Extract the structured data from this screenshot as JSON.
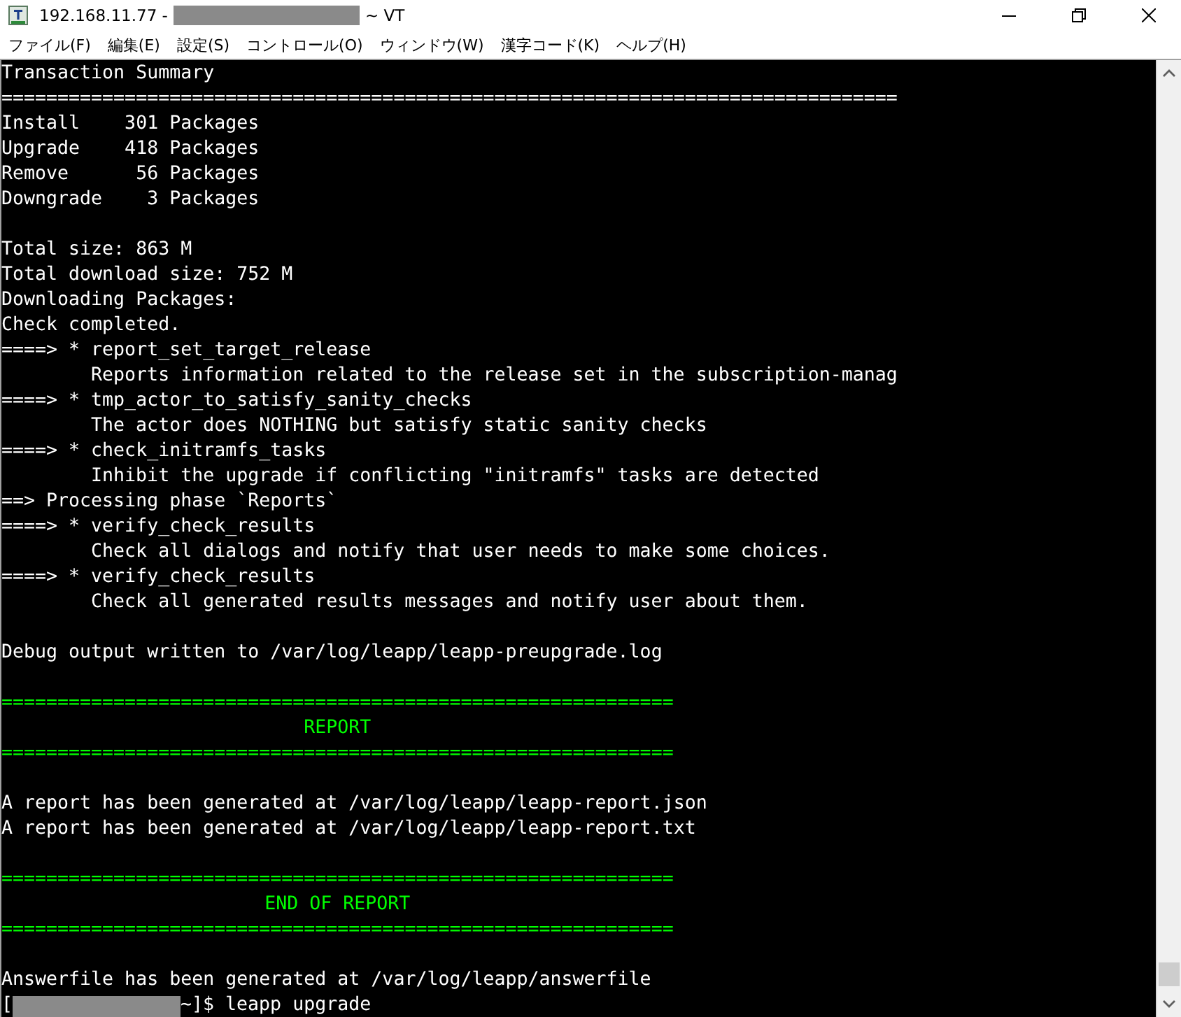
{
  "window": {
    "title_host": "192.168.11.77 -",
    "title_suffix": "~ VT"
  },
  "menu": [
    "ファイル(F)",
    "編集(E)",
    "設定(S)",
    "コントロール(O)",
    "ウィンドウ(W)",
    "漢字コード(K)",
    "ヘルプ(H)"
  ],
  "terminal": {
    "lines": [
      {
        "kind": "text",
        "text": "Transaction Summary"
      },
      {
        "kind": "text",
        "text": "================================================================================"
      },
      {
        "kind": "text",
        "text": "Install    301 Packages"
      },
      {
        "kind": "text",
        "text": "Upgrade    418 Packages"
      },
      {
        "kind": "text",
        "text": "Remove      56 Packages"
      },
      {
        "kind": "text",
        "text": "Downgrade    3 Packages"
      },
      {
        "kind": "blank"
      },
      {
        "kind": "text",
        "text": "Total size: 863 M"
      },
      {
        "kind": "text",
        "text": "Total download size: 752 M"
      },
      {
        "kind": "text",
        "text": "Downloading Packages:"
      },
      {
        "kind": "text",
        "text": "Check completed."
      },
      {
        "kind": "text",
        "text": "====> * report_set_target_release"
      },
      {
        "kind": "detail",
        "text": "Reports information related to the release set in the subscription-manag"
      },
      {
        "kind": "text",
        "text": "====> * tmp_actor_to_satisfy_sanity_checks"
      },
      {
        "kind": "detail",
        "text": "The actor does NOTHING but satisfy static sanity checks"
      },
      {
        "kind": "text",
        "text": "====> * check_initramfs_tasks"
      },
      {
        "kind": "detail",
        "text": "Inhibit the upgrade if conflicting \"initramfs\" tasks are detected"
      },
      {
        "kind": "text",
        "text": "==> Processing phase `Reports`"
      },
      {
        "kind": "text",
        "text": "====> * verify_check_results"
      },
      {
        "kind": "detail",
        "text": "Check all dialogs and notify that user needs to make some choices."
      },
      {
        "kind": "text",
        "text": "====> * verify_check_results"
      },
      {
        "kind": "detail",
        "text": "Check all generated results messages and notify user about them."
      },
      {
        "kind": "blank"
      },
      {
        "kind": "text",
        "text": "Debug output written to /var/log/leapp/leapp-preupgrade.log"
      },
      {
        "kind": "blank"
      },
      {
        "kind": "rule",
        "text": "============================================================"
      },
      {
        "kind": "banner",
        "text": "REPORT"
      },
      {
        "kind": "rule",
        "text": "============================================================"
      },
      {
        "kind": "blank"
      },
      {
        "kind": "text",
        "text": "A report has been generated at /var/log/leapp/leapp-report.json"
      },
      {
        "kind": "text",
        "text": "A report has been generated at /var/log/leapp/leapp-report.txt"
      },
      {
        "kind": "blank"
      },
      {
        "kind": "rule",
        "text": "============================================================"
      },
      {
        "kind": "banner",
        "text": "END OF REPORT"
      },
      {
        "kind": "rule",
        "text": "============================================================"
      },
      {
        "kind": "blank"
      },
      {
        "kind": "text",
        "text": "Answerfile has been generated at /var/log/leapp/answerfile"
      },
      {
        "kind": "prompt",
        "before": "[",
        "after": "~]$ leapp upgrade"
      }
    ]
  }
}
